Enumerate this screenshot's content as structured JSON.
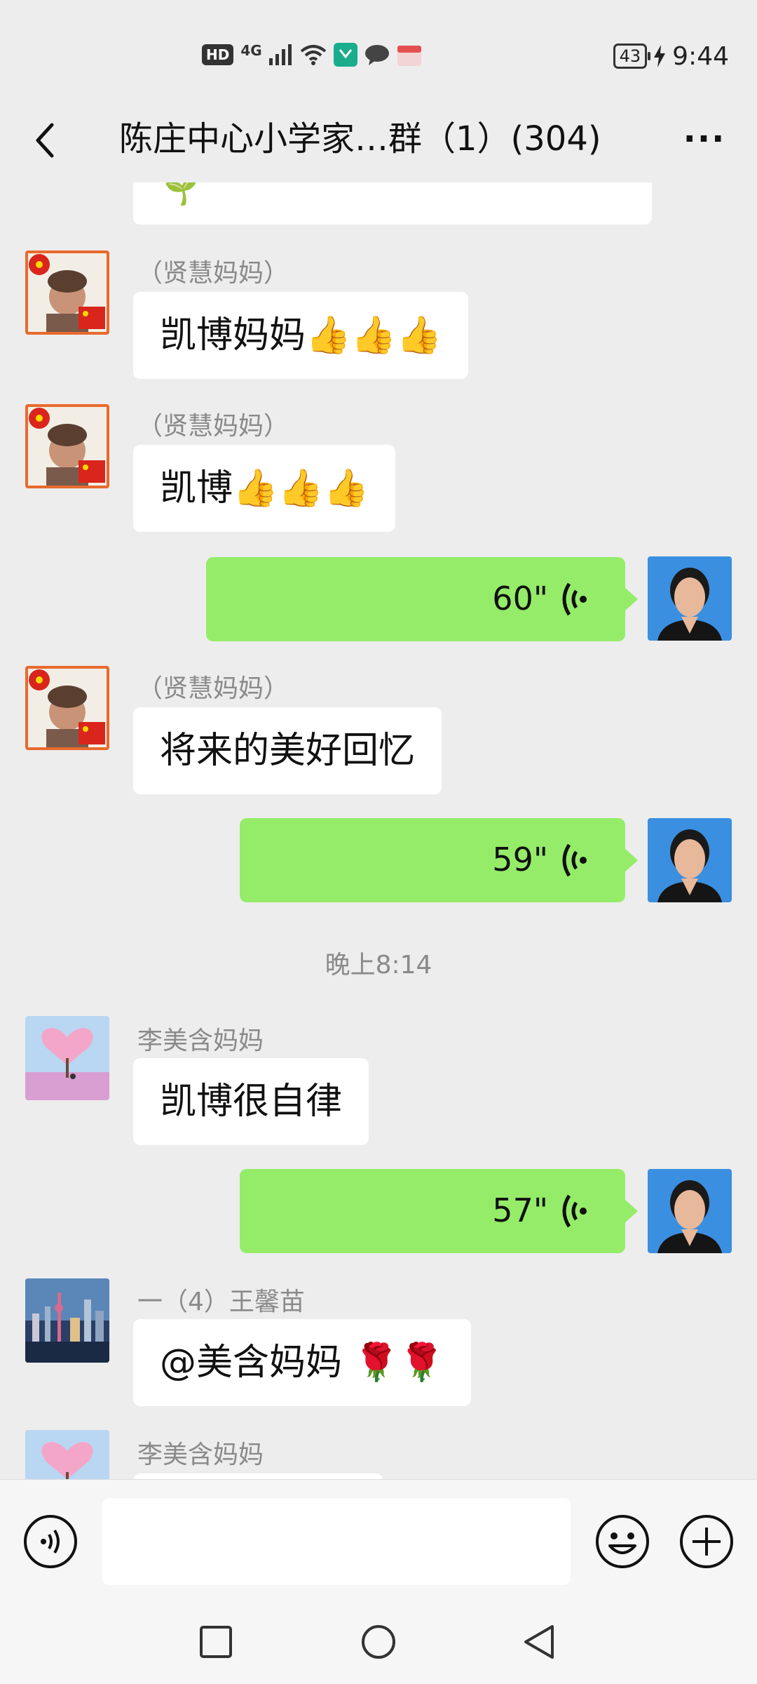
{
  "status_bar": {
    "hd": "HD",
    "network": "4G",
    "battery": "43",
    "time": "9:44"
  },
  "header": {
    "title": "陈庄中心小学家…群（1）(304)",
    "more": "···"
  },
  "messages": [
    {
      "sender": "（贤慧妈妈）",
      "text": "凯博妈妈👍👍👍"
    },
    {
      "sender": "（贤慧妈妈）",
      "text": "凯博👍👍👍"
    },
    {
      "voice": "60\""
    },
    {
      "sender": "（贤慧妈妈）",
      "text": "将来的美好回忆"
    },
    {
      "voice": "59\""
    },
    {
      "timestamp": "晚上8:14"
    },
    {
      "sender": "李美含妈妈",
      "text": "凯博很自律"
    },
    {
      "voice": "57\""
    },
    {
      "sender": "一（4）王馨苗",
      "text": "@美含妈妈 🌹🌹"
    },
    {
      "sender": "李美含妈妈"
    }
  ],
  "partial_top_message": "🌱",
  "colors": {
    "outgoing_bubble": "#95ec69",
    "incoming_bubble": "#ffffff",
    "background": "#ededed"
  },
  "icons": [
    "back-icon",
    "more-icon",
    "voice-input-icon",
    "emoji-icon",
    "plus-icon",
    "nav-square-icon",
    "nav-home-icon",
    "nav-back-icon"
  ]
}
